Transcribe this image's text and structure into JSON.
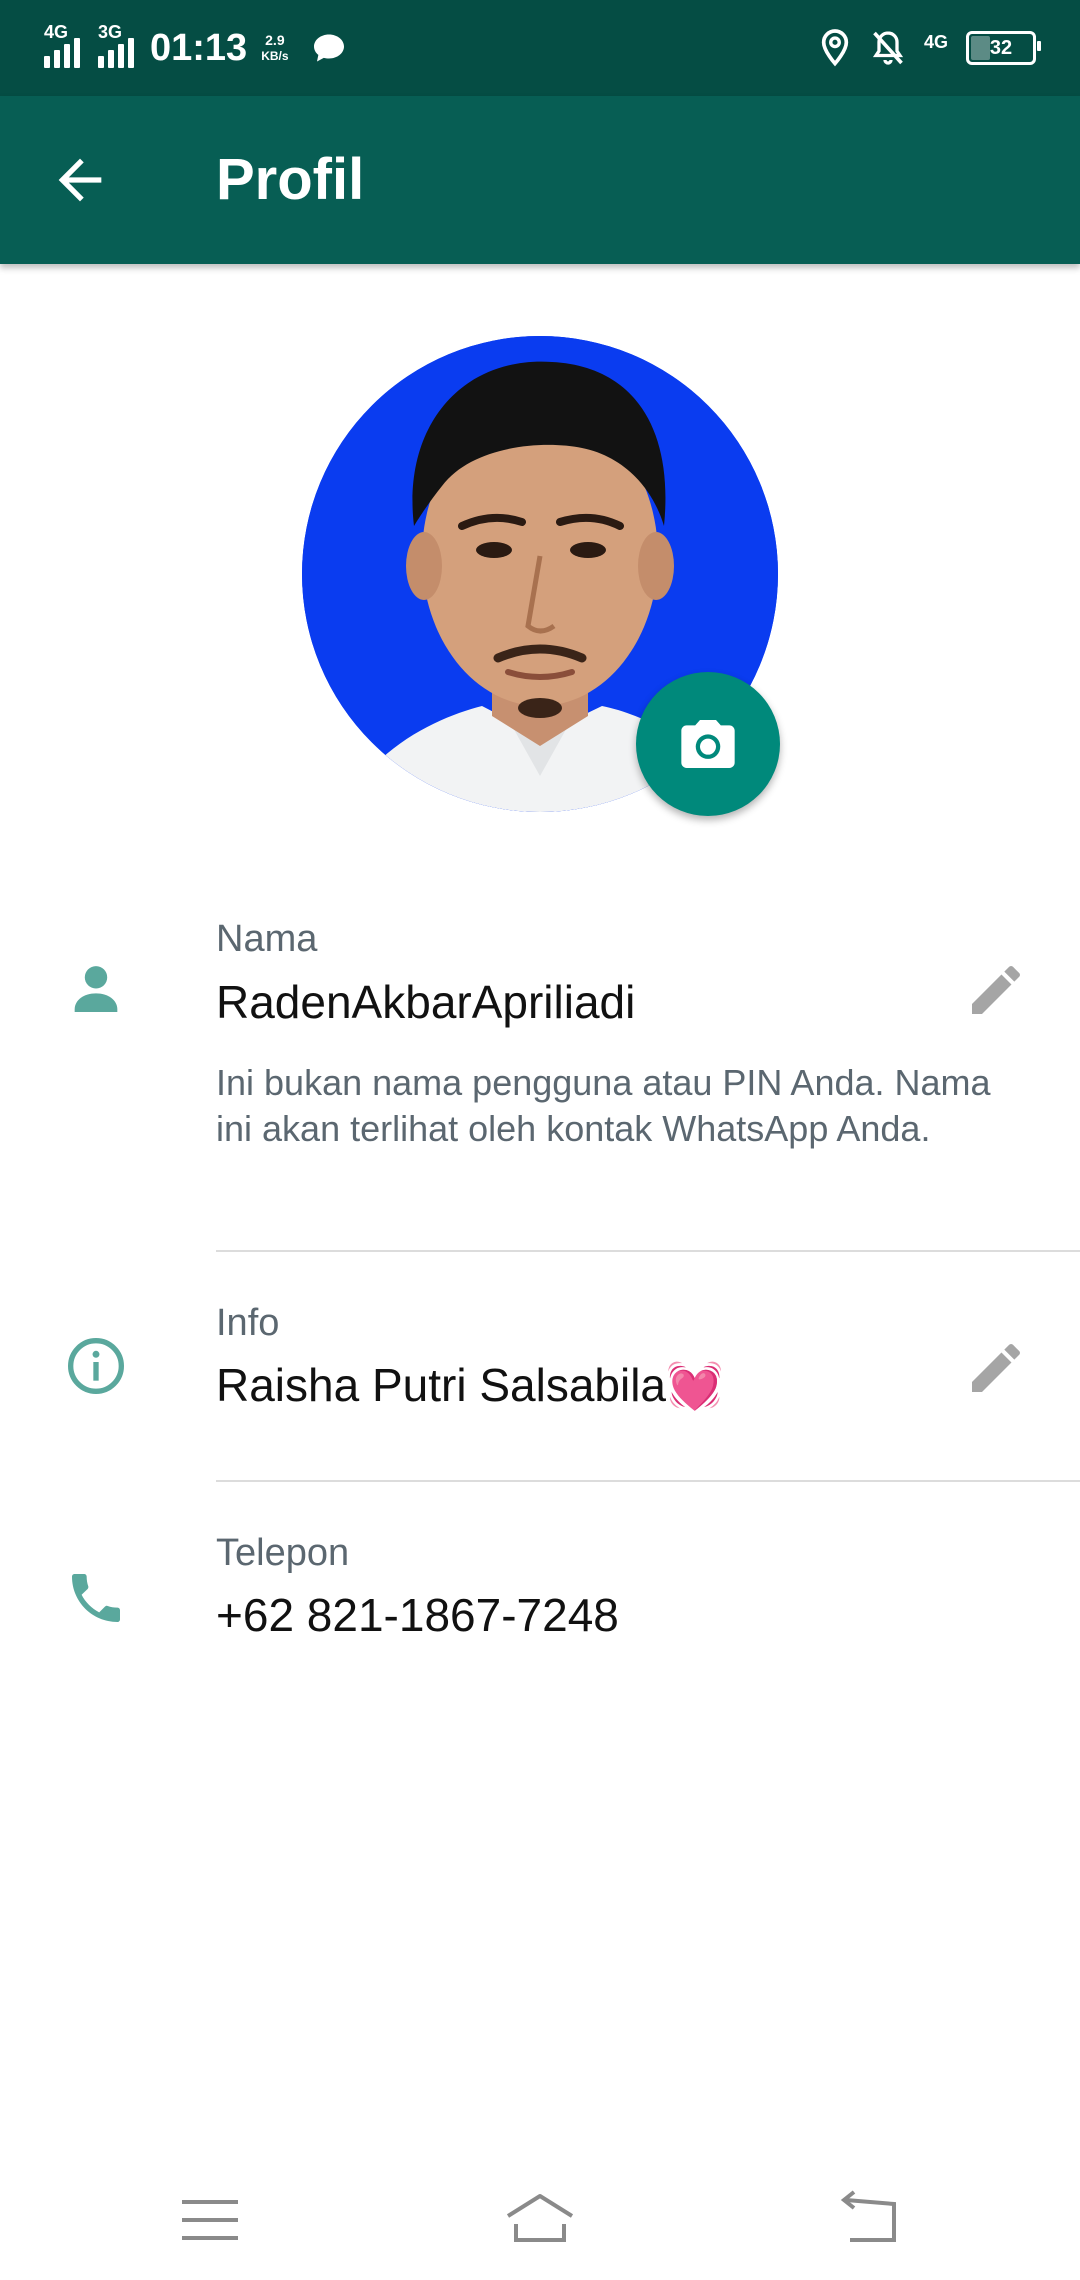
{
  "status_bar": {
    "sim1_label": "4G",
    "sim2_label": "3G",
    "time": "01:13",
    "speed_value": "2.9",
    "speed_unit": "KB/s",
    "network_right": "4G",
    "battery": "32",
    "battery_level": 0.32
  },
  "header": {
    "title": "Profil"
  },
  "profile": {
    "name_label": "Nama",
    "name_value": "RadenAkbarApriliadi",
    "name_hint": "Ini bukan nama pengguna atau PIN Anda. Nama ini akan terlihat oleh kontak WhatsApp Anda.",
    "info_label": "Info",
    "info_value": "Raisha Putri Salsabila💓",
    "phone_label": "Telepon",
    "phone_value": "+62 821-1867-7248"
  },
  "colors": {
    "status_bar": "#054d44",
    "app_bar": "#075e54",
    "accent": "#00897b",
    "icon_teal": "#5aa89d",
    "avatar_background": "#0a3cf0"
  }
}
